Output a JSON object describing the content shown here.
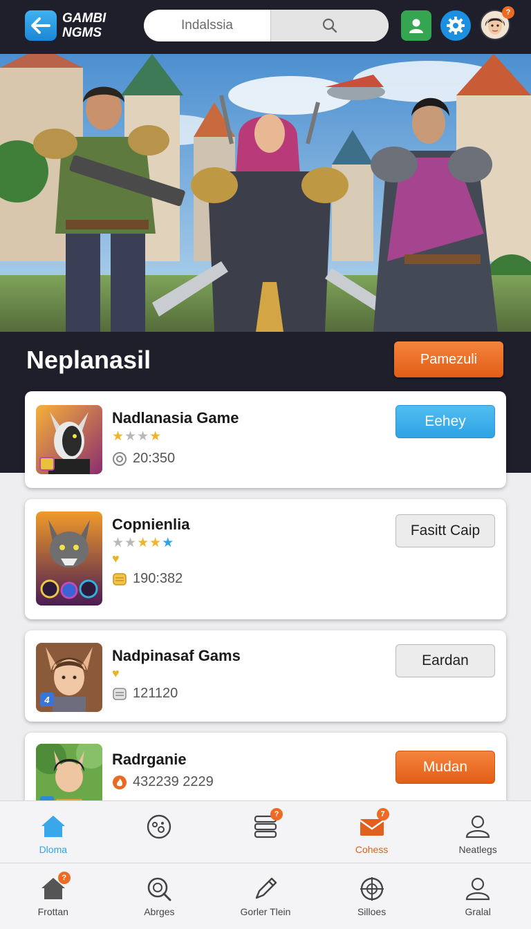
{
  "header": {
    "logo_line1": "GAMBI",
    "logo_line2": "NGMS",
    "search_placeholder": "Indalssia",
    "avatar_badge": "?"
  },
  "section": {
    "title": "Neplanasil",
    "primary_button": "Pamezuli"
  },
  "games": [
    {
      "title": "Nadlanasia Game",
      "rating_stars": 4,
      "stat": "20:350",
      "action": "Eehey"
    },
    {
      "title": "Copnienlia",
      "rating_stars": 5,
      "stat": "190:382",
      "action": "Fasitt Caip"
    },
    {
      "title": "Nadpinasaf Gams",
      "stat": "121120",
      "action": "Eardan"
    },
    {
      "title": "Radrganie",
      "stat": "432239 2229",
      "action": "Mudan"
    }
  ],
  "nav_top": [
    {
      "label": "Dloma",
      "icon": "home-icon"
    },
    {
      "label": "",
      "icon": "controller-icon"
    },
    {
      "label": "",
      "icon": "stack-icon",
      "badge": "?"
    },
    {
      "label": "Cohess",
      "icon": "mail-icon",
      "badge": "7"
    },
    {
      "label": "Neatlegs",
      "icon": "person-icon"
    }
  ],
  "nav_bottom": [
    {
      "label": "Frottan",
      "icon": "home-icon",
      "badge": "?"
    },
    {
      "label": "Abrges",
      "icon": "search-icon"
    },
    {
      "label": "Gorler Tlein",
      "icon": "pencil-icon"
    },
    {
      "label": "Silloes",
      "icon": "target-icon"
    },
    {
      "label": "Gralal",
      "icon": "person-icon"
    }
  ],
  "colors": {
    "header_bg": "#1f1f2b",
    "accent_orange": "#e8691f",
    "accent_blue": "#2ea3e8"
  }
}
